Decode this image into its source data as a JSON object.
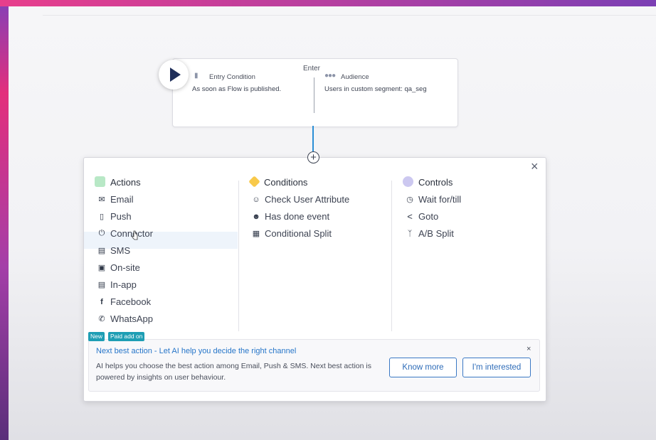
{
  "entry": {
    "enter_label": "Enter",
    "condition_title": "Entry Condition",
    "condition_desc": "As soon as Flow is published.",
    "audience_title": "Audience",
    "audience_desc": "Users in custom segment: qa_seg"
  },
  "panel": {
    "actions": {
      "heading": "Actions",
      "items": [
        "Email",
        "Push",
        "Connector",
        "SMS",
        "On-site",
        "In-app",
        "Facebook",
        "WhatsApp"
      ]
    },
    "conditions": {
      "heading": "Conditions",
      "items": [
        "Check User Attribute",
        "Has done event",
        "Conditional Split"
      ]
    },
    "controls": {
      "heading": "Controls",
      "items": [
        "Wait for/till",
        "Goto",
        "A/B Split"
      ]
    }
  },
  "banner": {
    "badge_new": "New",
    "badge_paid": "Paid add on",
    "title": "Next best action - Let AI help you decide the right channel",
    "text": "AI helps you choose the best action among Email, Push & SMS. Next best action is powered by insights on user behaviour.",
    "know_more": "Know more",
    "interested": "I'm interested",
    "close": "×"
  },
  "icons": {
    "close": "×",
    "plus": "+"
  },
  "colors": {
    "accent_blue": "#2b8fd6",
    "actions_dot": "#b8e8c6",
    "conditions_dot": "#f8c94a",
    "controls_dot": "#ccc8f0",
    "badge": "#1e9eb4"
  }
}
